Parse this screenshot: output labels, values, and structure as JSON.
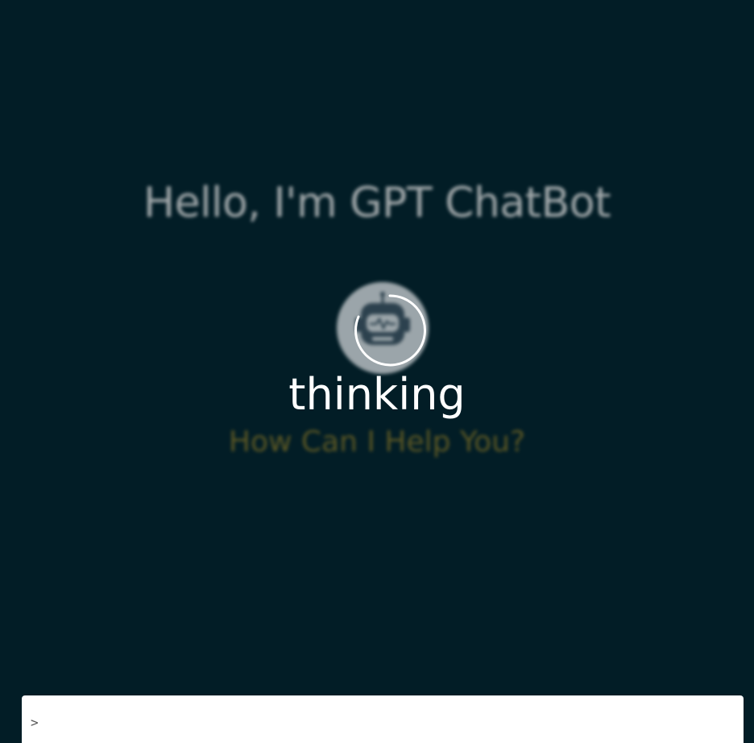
{
  "welcome": {
    "title": "Hello, I'm GPT ChatBot",
    "subtitle": "How Can I Help You?",
    "avatar_icon": "robot-icon"
  },
  "loading": {
    "label": "thinking",
    "spinner_icon": "spinner-icon"
  },
  "prompt": {
    "symbol": ">",
    "value": "",
    "placeholder": ""
  },
  "colors": {
    "background": "#021d26",
    "title": "#d7d7d7",
    "subtitle": "#7a6b24",
    "loading_text": "#ffffff"
  }
}
